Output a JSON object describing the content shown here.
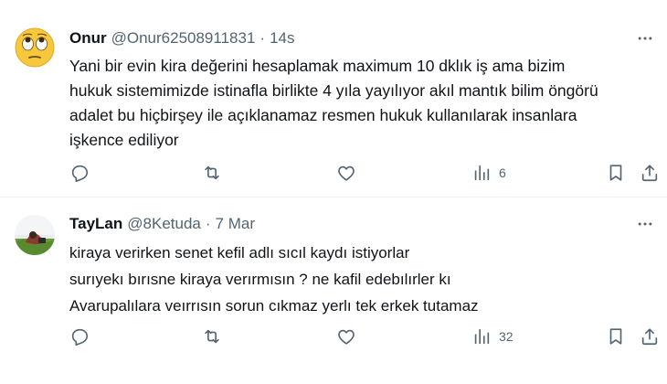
{
  "tweets": [
    {
      "display_name": "Onur",
      "handle": "@Onur62508911831",
      "separator": "·",
      "time": "14s",
      "text_lines": [
        "Yani bir evin kira değerini hesaplamak maximum 10 dklık iş ama bizim",
        "hukuk sistemimizde istinafla birlikte 4 yıla yayılıyor akıl mantık bilim öngörü",
        "adalet bu hiçbirşey ile açıklanamaz resmen hukuk kullanılarak insanlara",
        "işkence ediliyor"
      ],
      "replies": "",
      "reposts": "",
      "likes": "",
      "views": "6",
      "avatar_icon": "face-with-rolling-eyes-emoji"
    },
    {
      "display_name": "TayLan",
      "handle": "@8Ketuda",
      "separator": "·",
      "time": "7 Mar",
      "text_lines": [
        "kiraya verirken senet kefil adlı sıcıl kaydı istiyorlar",
        "surıyekı bırısne kiraya verırmısın ? ne  kafil edebılırler kı",
        "Avarupalılara veırrısın sorun cıkmaz yerlı  tek erkek tutamaz"
      ],
      "replies": "",
      "reposts": "",
      "likes": "",
      "views": "32",
      "avatar_icon": "profile-photo"
    }
  ],
  "icons": {
    "reply": "reply-icon",
    "repost": "repost-icon",
    "like": "like-icon",
    "views": "views-icon",
    "bookmark": "bookmark-icon",
    "share": "share-icon",
    "more": "more-icon"
  },
  "colors": {
    "text_primary": "#0f1419",
    "text_secondary": "#536471",
    "divider": "#eff3f4"
  }
}
